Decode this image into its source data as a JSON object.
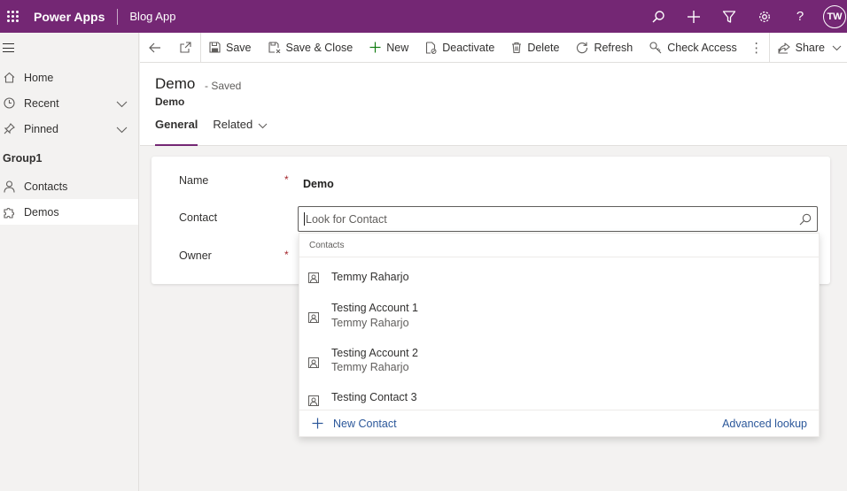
{
  "topbar": {
    "brand": "Power Apps",
    "app_name": "Blog App",
    "avatar_initials": "TW",
    "icons": [
      "search-icon",
      "plus-icon",
      "filter-icon",
      "gear-icon",
      "help-icon"
    ]
  },
  "sidebar": {
    "items": [
      {
        "label": "Home",
        "icon": "home-icon"
      },
      {
        "label": "Recent",
        "icon": "clock-icon"
      },
      {
        "label": "Pinned",
        "icon": "pin-icon"
      }
    ],
    "group_label": "Group1",
    "group_items": [
      {
        "label": "Contacts",
        "icon": "person-icon"
      },
      {
        "label": "Demos",
        "icon": "puzzle-icon"
      }
    ]
  },
  "commandbar": {
    "save": "Save",
    "save_close": "Save & Close",
    "new": "New",
    "deactivate": "Deactivate",
    "delete": "Delete",
    "refresh": "Refresh",
    "check_access": "Check Access",
    "share": "Share"
  },
  "header": {
    "title": "Demo",
    "saved_state": "- Saved",
    "entity": "Demo",
    "tabs": [
      "General",
      "Related"
    ]
  },
  "form": {
    "name_label": "Name",
    "name_value": "Demo",
    "contact_label": "Contact",
    "contact_placeholder": "Look for Contact",
    "owner_label": "Owner",
    "required_marker": "*"
  },
  "lookup_dropdown": {
    "header": "Contacts",
    "results": [
      {
        "primary": "Temmy Raharjo",
        "secondary": ""
      },
      {
        "primary": "Testing Account 1",
        "secondary": "Temmy Raharjo"
      },
      {
        "primary": "Testing Account 2",
        "secondary": "Temmy Raharjo"
      },
      {
        "primary": "Testing Contact 3",
        "secondary": ""
      }
    ],
    "new_label": "New Contact",
    "advanced_label": "Advanced lookup"
  },
  "colors": {
    "topbar": "#742774",
    "accent": "#742774",
    "link": "#2b579a",
    "required": "#a4262c"
  }
}
